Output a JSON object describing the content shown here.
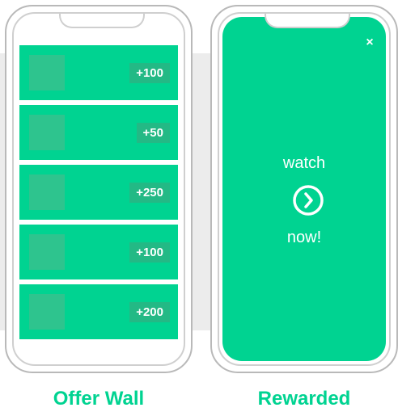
{
  "offer_wall": {
    "caption": "Offer Wall",
    "offers": [
      {
        "amount": "+100"
      },
      {
        "amount": "+50"
      },
      {
        "amount": "+250"
      },
      {
        "amount": "+100"
      },
      {
        "amount": "+200"
      }
    ]
  },
  "rewarded": {
    "caption": "Rewarded",
    "close_label": "×",
    "line1": "watch",
    "line2": "now!",
    "play_icon": "chevron-right-circle-icon"
  },
  "colors": {
    "accent": "#00d391",
    "thumb": "#2ec48e",
    "badge": "#23b985",
    "band": "#ececec",
    "phone_border": "#b9b9b9"
  }
}
